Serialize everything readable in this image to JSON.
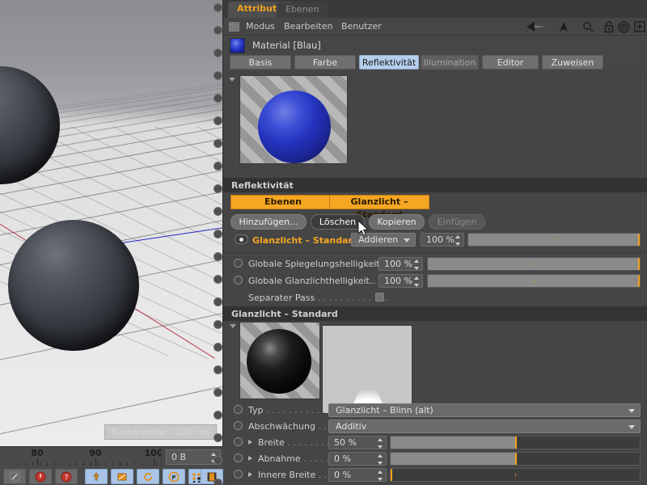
{
  "viewport": {
    "hud_text": "Rasterweite : 100 cm",
    "axis_z_color": "#1a1ac0",
    "axis_x_color": "#b32030"
  },
  "timeline": {
    "labels": [
      "80",
      "90",
      "100"
    ],
    "size_field_value": "0 B"
  },
  "panel": {
    "tabs": [
      {
        "label": "Attribute",
        "active": true
      },
      {
        "label": "Ebenen",
        "active": false
      }
    ],
    "menu": [
      {
        "label": "Modus"
      },
      {
        "label": "Bearbeiten"
      },
      {
        "label": "Benutzer"
      }
    ],
    "menu_icons": [
      "back-arrow-icon",
      "up-arrow-icon",
      "search-icon",
      "lock-icon",
      "target-icon",
      "plus-box-icon"
    ],
    "material": {
      "title": "Material [Blau]",
      "chip_color": "#2433bd",
      "tabs": [
        {
          "label": "Basis",
          "state": "normal"
        },
        {
          "label": "Farbe",
          "state": "normal"
        },
        {
          "label": "Reflektivität",
          "state": "selected"
        },
        {
          "label": "Illumination",
          "state": "dim"
        },
        {
          "label": "Editor",
          "state": "normal"
        },
        {
          "label": "Zuweisen",
          "state": "normal"
        }
      ]
    },
    "reflectivity": {
      "section_title": "Reflektivität",
      "subtabs": [
        {
          "label": "Ebenen"
        },
        {
          "label": "Glanzlicht – Standard"
        }
      ],
      "buttons": [
        {
          "label": "Hinzufügen...",
          "state": "normal"
        },
        {
          "label": "Löschen",
          "state": "hover"
        },
        {
          "label": "Kopieren",
          "state": "normal"
        },
        {
          "label": "Einfügen",
          "state": "disabled"
        }
      ],
      "layer": {
        "name": "Glanzlicht – Standard",
        "blend_mode": "Addieren",
        "opacity": "100 %",
        "opacity_percent": 100,
        "eye_icon": "eye-icon"
      },
      "globals": [
        {
          "label": "Globale Spiegelungshelligkeit",
          "value": "100 %",
          "percent": 100
        },
        {
          "label": "Globale Glanzlichthelligkeit",
          "value": "100 %",
          "percent": 100,
          "dots": ".."
        }
      ],
      "separate_pass": {
        "label": "Separater Pass",
        "dots": ". . . . . . . . . . . . .",
        "checked": false
      }
    },
    "specular": {
      "section_title": "Glanzlicht – Standard",
      "rows": [
        {
          "name": "typ",
          "label": "Typ",
          "dots": ". . . . . . . . . . . .",
          "kind": "dropdown",
          "value": "Glanzlicht – Blinn (alt)"
        },
        {
          "name": "abschwaechung",
          "label": "Abschwächung",
          "dots": ". . .",
          "kind": "dropdown",
          "value": "Additiv"
        },
        {
          "name": "breite",
          "label": "Breite",
          "dots": ". . . . . . . . .",
          "kind": "slider",
          "value": "50 %",
          "percent": 50,
          "expandable": true
        },
        {
          "name": "abnahme",
          "label": "Abnahme",
          "dots": ". . . . . .",
          "kind": "slider",
          "value": "0 %",
          "percent": 50,
          "expandable": true
        },
        {
          "name": "innere-breite",
          "label": "Innere Breite",
          "dots": ". . .",
          "kind": "slider",
          "value": "0 %",
          "percent": 0,
          "expandable": true
        }
      ]
    }
  },
  "colors": {
    "panel_bg": "#454545",
    "section_header_bg": "#333333",
    "accent_orange": "#f5a623",
    "selected_tab_blue": "#b6cdec"
  }
}
